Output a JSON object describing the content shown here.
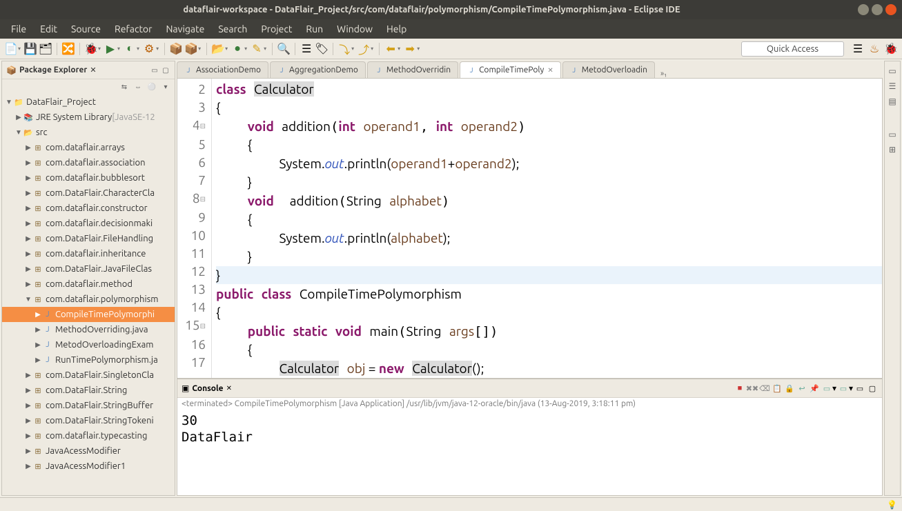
{
  "window": {
    "title": "dataflair-workspace - DataFlair_Project/src/com/dataflair/polymorphism/CompileTimePolymorphism.java - Eclipse IDE"
  },
  "menu": {
    "items": [
      "File",
      "Edit",
      "Source",
      "Refactor",
      "Navigate",
      "Search",
      "Project",
      "Run",
      "Window",
      "Help"
    ]
  },
  "toolbar": {
    "quick_access": "Quick Access"
  },
  "package_explorer": {
    "title": "Package Explorer",
    "project": "DataFlair_Project",
    "jre": "JRE System Library",
    "jre_suffix": " [JavaSE-12",
    "src": "src",
    "packages": [
      "com.dataflair.arrays",
      "com.dataflair.association",
      "com.dataflair.bubblesort",
      "com.DataFlair.CharacterCla",
      "com.dataflair.constructor",
      "com.dataflair.decisionmaki",
      "com.DataFlair.FileHandling",
      "com.dataflair.inheritance",
      "com.DataFlair.JavaFileClas",
      "com.dataflair.method"
    ],
    "open_package": "com.dataflair.polymorphism",
    "open_package_files": [
      "CompileTimePolymorphi",
      "MethodOverriding.java",
      "MetodOverloadingExam",
      "RunTimePolymorphism.ja"
    ],
    "packages_after": [
      "com.DataFlair.SingletonCla",
      "com.DataFlair.String",
      "com.DataFlair.StringBuffer",
      "com.DataFlair.StringTokeni",
      "com.dataflair.typecasting",
      "JavaAcessModifier",
      "JavaAcessModifier1"
    ]
  },
  "editor": {
    "tabs": [
      {
        "label": "AssociationDemo",
        "active": false
      },
      {
        "label": "AggregationDemo",
        "active": false
      },
      {
        "label": "MethodOverridin",
        "active": false
      },
      {
        "label": "CompileTimePoly",
        "active": true
      },
      {
        "label": "MetodOverloadin",
        "active": false
      }
    ],
    "overflow": "»₁"
  },
  "code": {
    "line2": {
      "kw": "class",
      "name": "Calculator"
    },
    "line3": "{",
    "line4": {
      "kw": "void",
      "fn": "addition",
      "kwint1": "int",
      "p1": "operand1",
      "kwint2": "int",
      "p2": "operand2"
    },
    "line5": "{",
    "line6": {
      "sys": "System.",
      "out": "out",
      "print": ".println(",
      "p1": "operand1",
      "plus": "+",
      "p2": "operand2",
      "end": ");"
    },
    "line7": "}",
    "line8": {
      "kw": "void",
      "fn": "addition",
      "ptype": "String",
      "p": "alphabet"
    },
    "line9": "{",
    "line10": {
      "sys": "System.",
      "out": "out",
      "print": ".println(",
      "p": "alphabet",
      "end": ");"
    },
    "line11": "}",
    "line12": "}",
    "line13": {
      "kw1": "public",
      "kw2": "class",
      "name": "CompileTimePolymorphism"
    },
    "line14": "{",
    "line15": {
      "kw1": "public",
      "kw2": "static",
      "kw3": "void",
      "fn": "main",
      "ptype": "String",
      "p": "args"
    },
    "line16": "{",
    "line17": {
      "cls1": "Calculator",
      "var": "obj",
      "eq": " = ",
      "kw": "new",
      "cls2": "Calculator",
      "end": "();"
    }
  },
  "console": {
    "title": "Console",
    "info": "<terminated> CompileTimePolymorphism [Java Application] /usr/lib/jvm/java-12-oracle/bin/java (13-Aug-2019, 3:18:11 pm)",
    "output": "30\nDataFlair"
  }
}
